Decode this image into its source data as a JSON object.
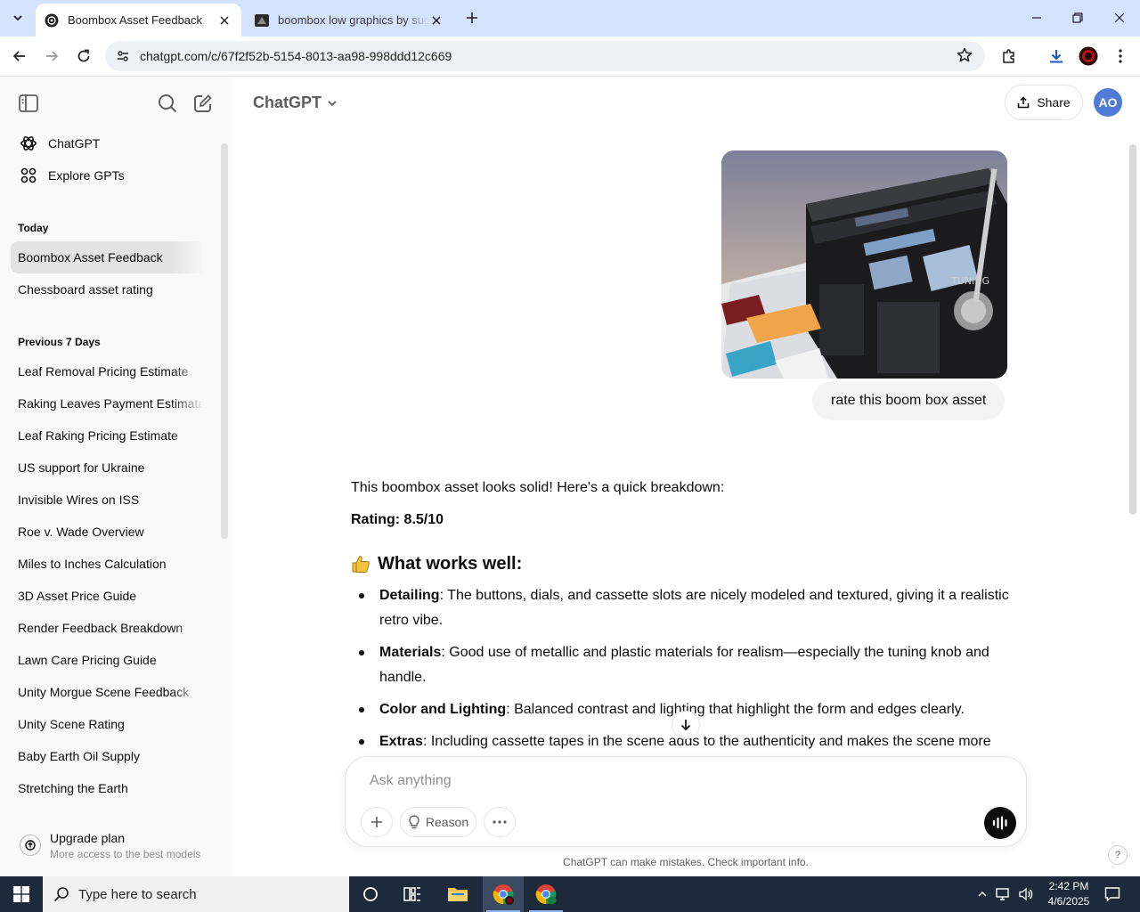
{
  "browser": {
    "tabs": [
      {
        "title": "Boombox Asset Feedback",
        "active": true
      },
      {
        "title": "boombox low graphics by sugar",
        "active": false
      }
    ],
    "url": "chatgpt.com/c/67f2f52b-5154-8013-aa98-998ddd12c669"
  },
  "sidebar": {
    "nav": [
      {
        "label": "ChatGPT",
        "icon": "openai-logo-icon"
      },
      {
        "label": "Explore GPTs",
        "icon": "grid-icon"
      }
    ],
    "sections": [
      {
        "title": "Today",
        "items": [
          "Boombox Asset Feedback",
          "Chessboard asset rating"
        ]
      },
      {
        "title": "Previous 7 Days",
        "items": [
          "Leaf Removal Pricing Estimate",
          "Raking Leaves Payment Estimate",
          "Leaf Raking Pricing Estimate",
          "US support for Ukraine",
          "Invisible Wires on ISS",
          "Roe v. Wade Overview",
          "Miles to Inches Calculation",
          "3D Asset Price Guide",
          "Render Feedback Breakdown",
          "Lawn Care Pricing Guide",
          "Unity Morgue Scene Feedback",
          "Unity Scene Rating",
          "Baby Earth Oil Supply",
          "Stretching the Earth"
        ]
      }
    ],
    "upgrade": {
      "title": "Upgrade plan",
      "subtitle": "More access to the best models"
    }
  },
  "header": {
    "model": "ChatGPT",
    "share_label": "Share",
    "avatar_initials": "AO"
  },
  "conversation": {
    "user_message": "rate this boom box asset",
    "image_label_tuning": "TUNING",
    "assistant": {
      "intro": "This boombox asset looks solid! Here's a quick breakdown:",
      "rating": "Rating: 8.5/10",
      "section_title": "What works well:",
      "bullets": [
        {
          "term": "Detailing",
          "text": ": The buttons, dials, and cassette slots are nicely modeled and textured, giving it a realistic retro vibe."
        },
        {
          "term": "Materials",
          "text": ": Good use of metallic and plastic materials for realism—especially the tuning knob and handle."
        },
        {
          "term": "Color and Lighting",
          "text": ": Balanced contrast and lighting that highlight the form and edges clearly."
        },
        {
          "term": "Extras",
          "text": ": Including cassette tapes in the scene adds to the authenticity and makes the scene more"
        }
      ]
    }
  },
  "composer": {
    "placeholder": "Ask anything",
    "reason_label": "Reason"
  },
  "disclaimer": "ChatGPT can make mistakes. Check important info.",
  "help_label": "?",
  "taskbar": {
    "search_placeholder": "Type here to search",
    "time": "2:42 PM",
    "date": "4/6/2025"
  },
  "colors": {
    "tabstrip": "#d3e3fd",
    "sidebar": "#f9f9f9",
    "avatar": "#4f7bd6",
    "taskbar": "#1c2a3c"
  }
}
